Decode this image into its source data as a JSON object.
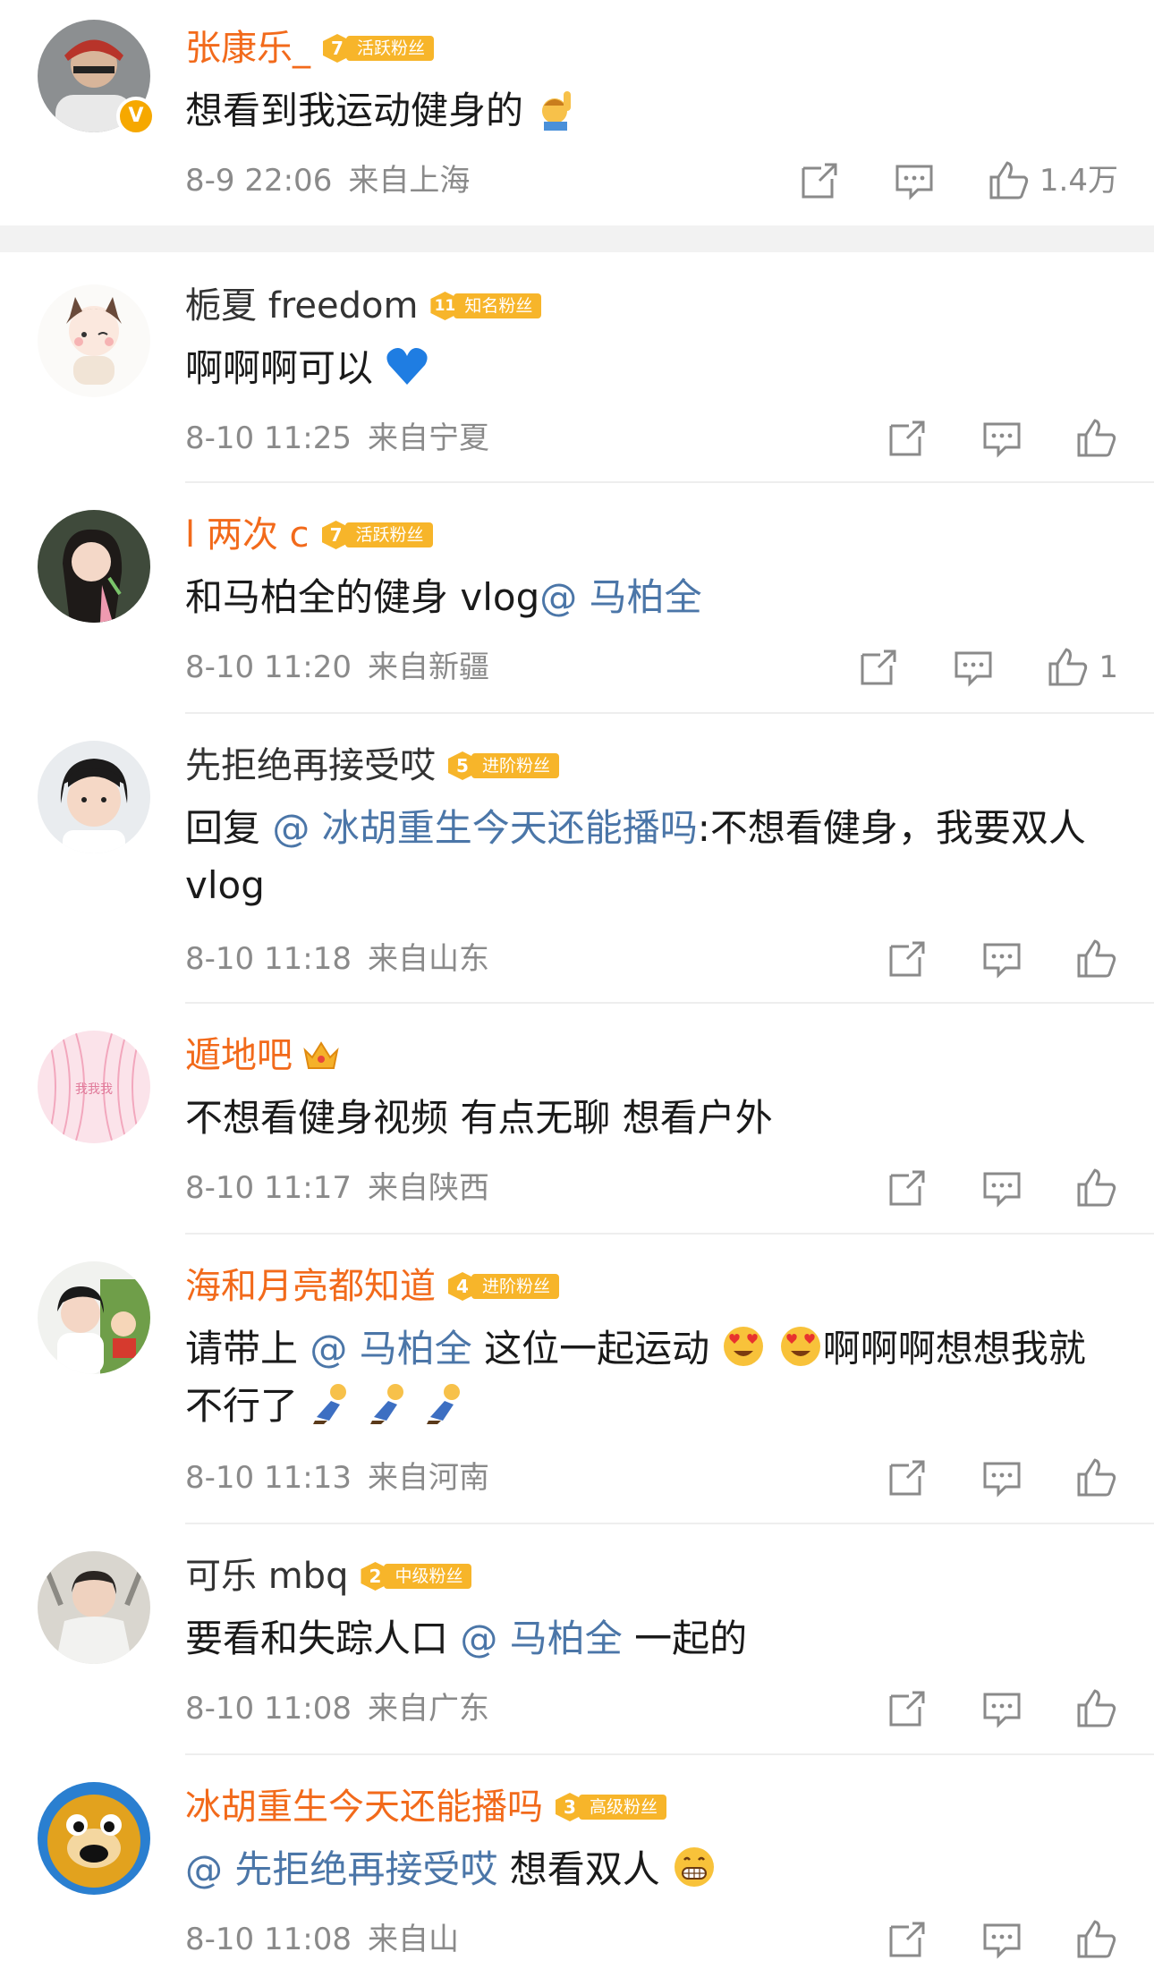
{
  "colors": {
    "accent": "#f26a1b",
    "mention": "#4b76a8",
    "meta": "#8a8a8a",
    "badge": "#f7b52a"
  },
  "comments": [
    {
      "name": "张康乐_",
      "fan_level": "7",
      "fan_label": "活跃粉丝",
      "verified_badge": "V",
      "text": "想看到我运动健身的",
      "time": "8-9 22:06",
      "location": "来自上海",
      "likes": "1.4万"
    },
    {
      "name": "栀夏 freedom",
      "fan_level": "11",
      "fan_label": "知名粉丝",
      "text": "啊啊啊可以",
      "time": "8-10 11:25",
      "location": "来自宁夏"
    },
    {
      "name": "l 两次 c",
      "fan_level": "7",
      "fan_label": "活跃粉丝",
      "text_pre": "和马柏全的健身 vlog",
      "mention": "@ 马柏全",
      "time": "8-10 11:20",
      "location": "来自新疆",
      "likes": "1"
    },
    {
      "name": "先拒绝再接受哎",
      "fan_level": "5",
      "fan_label": "进阶粉丝",
      "text_pre": "回复 ",
      "mention": "@ 冰胡重生今天还能播吗",
      "text_post": ":不想看健身，我要双人 vlog",
      "time": "8-10 11:18",
      "location": "来自山东"
    },
    {
      "name": "遁地吧",
      "text": "不想看健身视频 有点无聊  想看户外",
      "time": "8-10 11:17",
      "location": "来自陕西",
      "avatar_text": "我我我"
    },
    {
      "name": "海和月亮都知道",
      "fan_level": "4",
      "fan_label": "进阶粉丝",
      "text_pre": "请带上 ",
      "mention": "@ 马柏全",
      "text_mid": " 这位一起运动",
      "text_after": "啊啊啊想想我就不行了",
      "time": "8-10 11:13",
      "location": "来自河南"
    },
    {
      "name": "可乐 mbq",
      "fan_level": "2",
      "fan_label": "中级粉丝",
      "text_pre": "要看和失踪人口 ",
      "mention": "@ 马柏全",
      "text_post": " 一起的",
      "time": "8-10 11:08",
      "location": "来自广东"
    },
    {
      "name": "冰胡重生今天还能播吗",
      "fan_level": "3",
      "fan_label": "高级粉丝",
      "mention": "@ 先拒绝再接受哎",
      "text_post": " 想看双人",
      "time": "8-10 11:08",
      "location": "来自山"
    }
  ]
}
